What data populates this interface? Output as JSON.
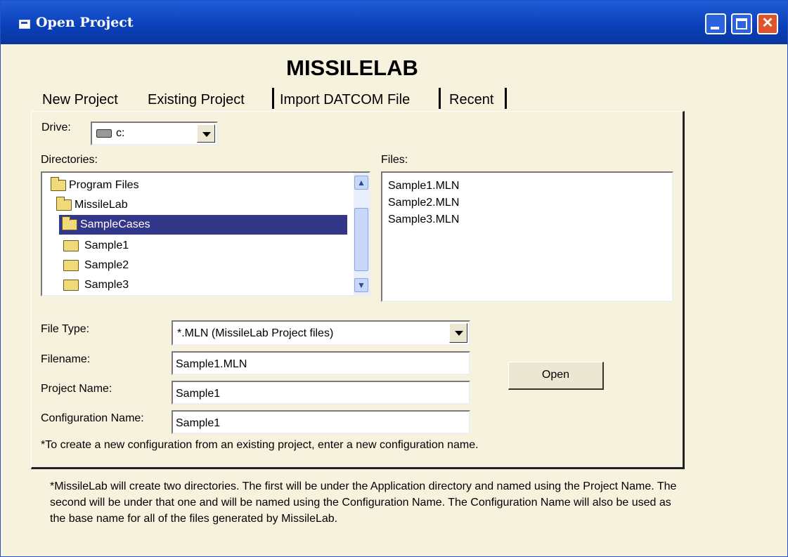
{
  "window": {
    "title": "Open Project"
  },
  "app_title": "MISSILELAB",
  "tabs": [
    {
      "label": "New Project"
    },
    {
      "label": "Existing Project"
    },
    {
      "label": "Import DATCOM File"
    },
    {
      "label": "Recent"
    }
  ],
  "drive": {
    "label": "Drive:",
    "value": "c:"
  },
  "directories": {
    "label": "Directories:",
    "items": [
      {
        "name": "Program Files"
      },
      {
        "name": "MissileLab"
      },
      {
        "name": "SampleCases"
      },
      {
        "name": "Sample1"
      },
      {
        "name": "Sample2"
      },
      {
        "name": "Sample3"
      }
    ],
    "selected": "SampleCases"
  },
  "files": {
    "label": "Files:",
    "items": [
      "Sample1.MLN",
      "Sample2.MLN",
      "Sample3.MLN"
    ]
  },
  "form": {
    "file_type_label": "File Type:",
    "file_type_value": "*.MLN (MissileLab Project files)",
    "filename_label": "Filename:",
    "filename_value": "Sample1.MLN",
    "project_name_label": "Project Name:",
    "project_name_value": "Sample1",
    "configuration_name_label": "Configuration Name:",
    "configuration_name_value": "Sample1",
    "open_label": "Open"
  },
  "note": "*To create a new configuration from an existing project, enter a new configuration name.",
  "footer": "*MissileLab will create two directories.  The first will be under the Application directory and named using the Project Name.  The second will be under that one and will be named using the Configuration Name.  The Configuration Name will also be used as the base name for all of the files generated by MissileLab."
}
